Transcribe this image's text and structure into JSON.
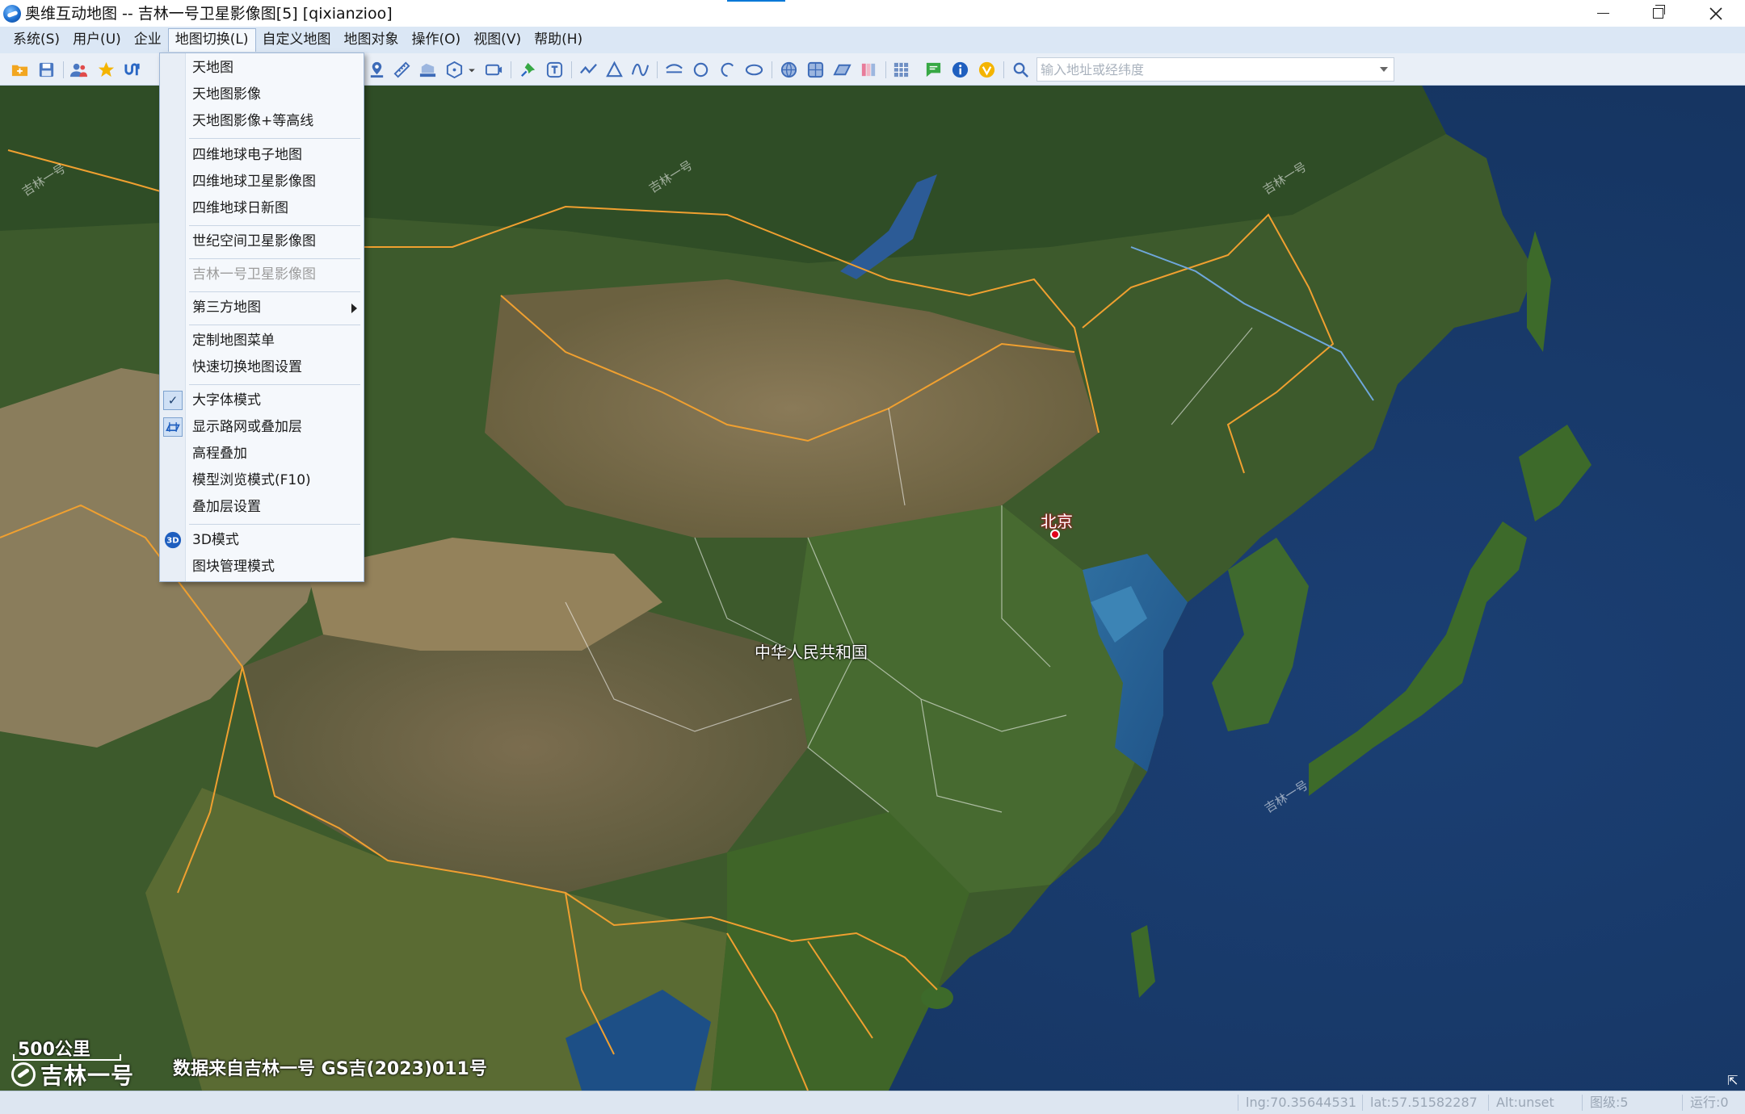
{
  "window": {
    "title": "奥维互动地图 -- 吉林一号卫星影像图[5] [qixianzioo]"
  },
  "menubar": {
    "items": [
      {
        "label": "系统(S)"
      },
      {
        "label": "用户(U)"
      },
      {
        "label": "企业"
      },
      {
        "label": "地图切换(L)"
      },
      {
        "label": "自定义地图"
      },
      {
        "label": "地图对象"
      },
      {
        "label": "操作(O)"
      },
      {
        "label": "视图(V)"
      },
      {
        "label": "帮助(H)"
      }
    ]
  },
  "search": {
    "placeholder": "输入地址或经纬度",
    "value": ""
  },
  "dropdown": {
    "items": [
      {
        "label": "天地图"
      },
      {
        "label": "天地图影像"
      },
      {
        "label": "天地图影像+等高线"
      },
      {
        "label": "四维地球电子地图"
      },
      {
        "label": "四维地球卫星影像图"
      },
      {
        "label": "四维地球日新图"
      },
      {
        "label": "世纪空间卫星影像图"
      },
      {
        "label": "吉林一号卫星影像图",
        "state": "disabled"
      },
      {
        "label": "第三方地图",
        "submenu": true
      },
      {
        "label": "定制地图菜单"
      },
      {
        "label": "快速切换地图设置"
      },
      {
        "label": "大字体模式",
        "checked": true
      },
      {
        "label": "显示路网或叠加层",
        "icon": "overlay-icon"
      },
      {
        "label": "高程叠加"
      },
      {
        "label": "模型浏览模式(F10)"
      },
      {
        "label": "叠加层设置"
      },
      {
        "label": "3D模式",
        "icon": "3d-icon"
      },
      {
        "label": "图块管理模式"
      }
    ]
  },
  "map": {
    "labels": {
      "beijing": "北京",
      "country": "中华人民共和国",
      "watermark": "吉林一号"
    },
    "scale": "500公里",
    "logo": "吉林一号",
    "attribution": "数据来自吉林一号 GS吉(2023)011号",
    "resize_glyph": "⇱"
  },
  "statusbar": {
    "lng": "lng:70.35644531",
    "lat": "lat:57.51582287",
    "alt": "Alt:unset",
    "level": "图级:5",
    "running": "运行:0"
  },
  "colors": {
    "menubar_bg": "#dbe7f5",
    "toolbar_bg": "#e9eff7",
    "border_orange": "#f0a030",
    "beijing_marker": "#e0001b"
  }
}
